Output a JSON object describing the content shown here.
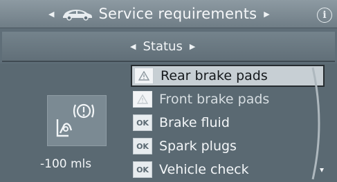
{
  "header": {
    "title": "Service requirements",
    "info_label": "i",
    "icon": "car-icon"
  },
  "subheader": {
    "title": "Status"
  },
  "left_panel": {
    "icon": "brake-warning-icon",
    "mileage": "-100 mls"
  },
  "list": {
    "items": [
      {
        "label": "Rear brake pads",
        "status": "warning",
        "badge": "",
        "selected": true
      },
      {
        "label": "Front brake pads",
        "status": "warning-dim",
        "badge": "",
        "selected": false
      },
      {
        "label": "Brake fluid",
        "status": "ok",
        "badge": "OK",
        "selected": false
      },
      {
        "label": "Spark plugs",
        "status": "ok",
        "badge": "OK",
        "selected": false
      },
      {
        "label": "Vehicle check",
        "status": "ok",
        "badge": "OK",
        "selected": false
      }
    ]
  },
  "colors": {
    "background": "#5f6e78",
    "selection": "#c7cfd4",
    "ok_badge": "#e7ecef"
  }
}
